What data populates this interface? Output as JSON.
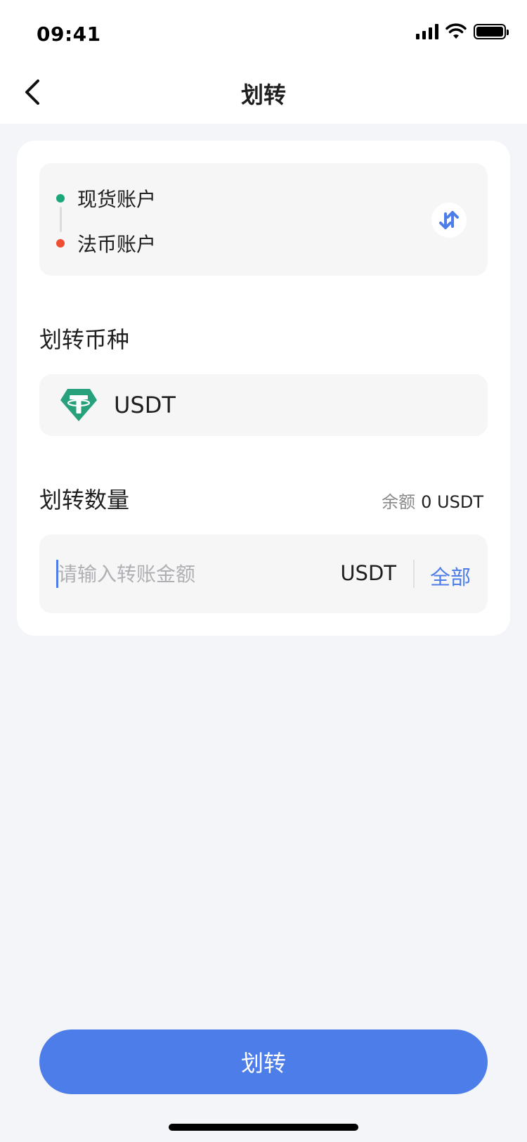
{
  "status_bar": {
    "time": "09:41",
    "icons": [
      "signal-icon",
      "wifi-icon",
      "battery-icon"
    ]
  },
  "nav": {
    "back_icon": "chevron-left-icon",
    "title": "划转"
  },
  "accounts": {
    "from": {
      "label": "现货账户",
      "dot_color": "#1aa87b"
    },
    "to": {
      "label": "法币账户",
      "dot_color": "#ef4e32"
    },
    "swap_icon": "swap-arrows-icon"
  },
  "coin": {
    "section_label": "划转币种",
    "icon": "tether-logo-icon",
    "name": "USDT"
  },
  "amount": {
    "section_label": "划转数量",
    "balance_label": "余额",
    "balance_value": "0 USDT",
    "placeholder": "请输入转账金额",
    "unit": "USDT",
    "all_label": "全部"
  },
  "submit": {
    "label": "划转"
  },
  "colors": {
    "accent": "#4d7de8",
    "tether": "#26a17b",
    "background": "#f4f5f9",
    "field": "#f6f6f7"
  }
}
